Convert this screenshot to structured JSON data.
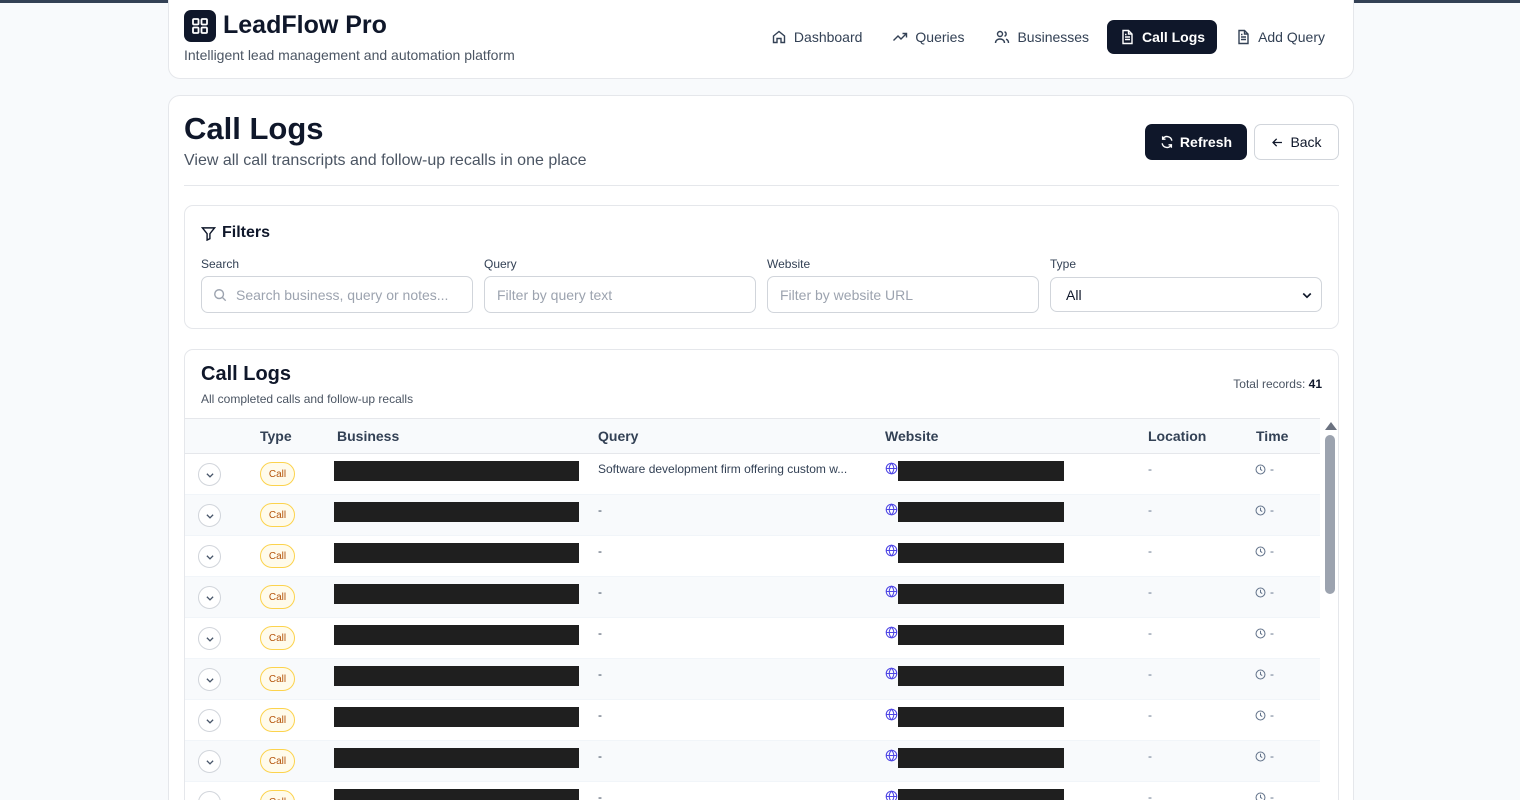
{
  "app": {
    "title": "LeadFlow Pro",
    "subtitle": "Intelligent lead management and automation platform"
  },
  "nav": [
    {
      "label": "Dashboard",
      "icon": "home-icon",
      "active": false
    },
    {
      "label": "Queries",
      "icon": "trending-up-icon",
      "active": false
    },
    {
      "label": "Businesses",
      "icon": "users-icon",
      "active": false
    },
    {
      "label": "Call Logs",
      "icon": "file-text-icon",
      "active": true
    },
    {
      "label": "Add Query",
      "icon": "file-plus-icon",
      "active": false
    }
  ],
  "page": {
    "title": "Call Logs",
    "subtitle": "View all call transcripts and follow-up recalls in one place",
    "refresh_label": "Refresh",
    "back_label": "Back"
  },
  "filters": {
    "title": "Filters",
    "search_label": "Search",
    "search_placeholder": "Search business, query or notes...",
    "query_label": "Query",
    "query_placeholder": "Filter by query text",
    "website_label": "Website",
    "website_placeholder": "Filter by website URL",
    "type_label": "Type",
    "type_value": "All"
  },
  "logs": {
    "title": "Call Logs",
    "subtitle": "All completed calls and follow-up recalls",
    "total_label": "Total records:",
    "total_value": "41",
    "columns": [
      "Type",
      "Business",
      "Query",
      "Website",
      "Location",
      "Time"
    ],
    "rows": [
      {
        "type": "Call",
        "query": "Software development firm offering custom w...",
        "location": "-",
        "time": "-"
      },
      {
        "type": "Call",
        "query": "-",
        "location": "-",
        "time": "-"
      },
      {
        "type": "Call",
        "query": "-",
        "location": "-",
        "time": "-"
      },
      {
        "type": "Call",
        "query": "-",
        "location": "-",
        "time": "-"
      },
      {
        "type": "Call",
        "query": "-",
        "location": "-",
        "time": "-"
      },
      {
        "type": "Call",
        "query": "-",
        "location": "-",
        "time": "-"
      },
      {
        "type": "Call",
        "query": "-",
        "location": "-",
        "time": "-"
      },
      {
        "type": "Call",
        "query": "-",
        "location": "-",
        "time": "-"
      },
      {
        "type": "Call",
        "query": "-",
        "location": "-",
        "time": "-"
      }
    ]
  },
  "colors": {
    "primary": "#0f172a",
    "badge_bg": "#fffbeb",
    "badge_border": "#fcd34d",
    "badge_text": "#b45309",
    "globe": "#4f46e5"
  }
}
